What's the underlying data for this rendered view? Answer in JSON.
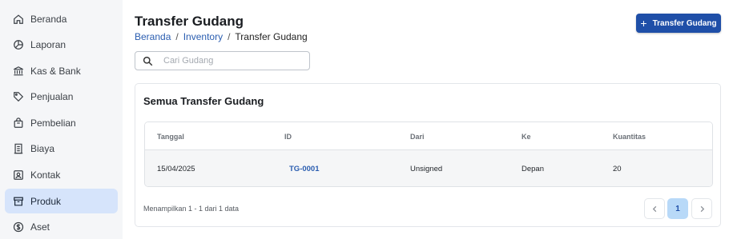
{
  "sidebar": {
    "items": [
      {
        "label": "Beranda",
        "icon": "home-icon"
      },
      {
        "label": "Laporan",
        "icon": "pie-chart-icon"
      },
      {
        "label": "Kas & Bank",
        "icon": "bank-icon"
      },
      {
        "label": "Penjualan",
        "icon": "tag-icon"
      },
      {
        "label": "Pembelian",
        "icon": "shopping-bag-icon"
      },
      {
        "label": "Biaya",
        "icon": "receipt-icon"
      },
      {
        "label": "Kontak",
        "icon": "contact-icon"
      },
      {
        "label": "Produk",
        "icon": "box-icon",
        "active": true
      },
      {
        "label": "Aset",
        "icon": "dollar-icon"
      }
    ]
  },
  "header": {
    "title": "Transfer Gudang",
    "breadcrumb": [
      "Beranda",
      "Inventory",
      "Transfer Gudang"
    ],
    "primary_button": "Transfer Gudang"
  },
  "search": {
    "placeholder": "Cari Gudang",
    "value": ""
  },
  "card": {
    "title": "Semua Transfer Gudang",
    "columns": [
      "Tanggal",
      "ID",
      "Dari",
      "Ke",
      "Kuantitas"
    ],
    "rows": [
      [
        "15/04/2025",
        "TG-0001",
        "Unsigned",
        "Depan",
        "20"
      ]
    ],
    "footer": "Menampilkan 1 - 1 dari 1 data",
    "current_page": "1"
  },
  "colors": {
    "accent": "#1f4fa8",
    "active_nav": "#d6e4fb",
    "link": "#2a5db0",
    "current_page_bg": "#b8d9f8"
  }
}
